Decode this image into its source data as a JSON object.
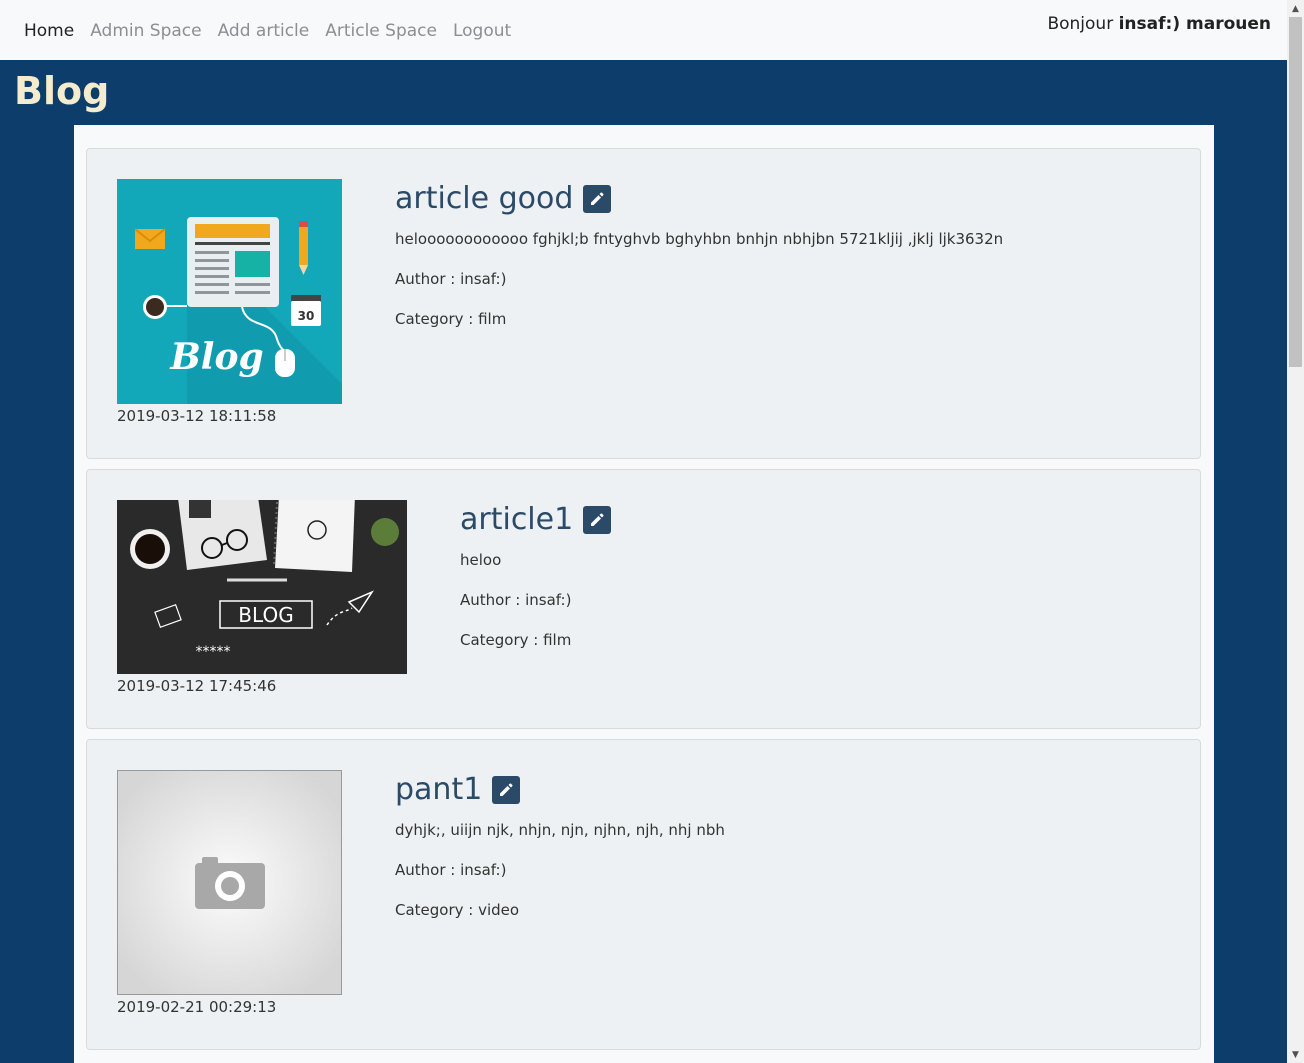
{
  "nav": {
    "links": [
      "Home",
      "Admin Space",
      "Add article",
      "Article Space",
      "Logout"
    ],
    "greeting_prefix": "Bonjour",
    "greeting_user": "insaf:) marouen"
  },
  "page_title": "Blog",
  "articles": [
    {
      "title": "article good",
      "description": "heloooooooooooo fghjkl;b fntyghvb bghyhbn bnhjn nbhjbn 5721kljij ,jklj ljk3632n",
      "author": "Author : insaf:)",
      "category": "Category : film",
      "date": "2019-03-12 18:11:58",
      "image": "blog-illustration-icon"
    },
    {
      "title": "article1",
      "description": "heloo",
      "author": "Author : insaf:)",
      "category": "Category : film",
      "date": "2019-03-12 17:45:46",
      "image": "blog-desk-photo"
    },
    {
      "title": "pant1",
      "description": "dyhjk;, uiijn njk, nhjn, njn, njhn, njh, nhj nbh",
      "author": "Author : insaf:)",
      "category": "Category : video",
      "date": "2019-02-21 00:29:13",
      "image": "camera-placeholder-icon"
    }
  ],
  "thumb_texts": {
    "blog_script": "Blog",
    "calendar_day": "30",
    "desk_label": "BLOG",
    "stars": "*****"
  },
  "colors": {
    "background": "#0d3d6b",
    "title_color": "#2b4a68",
    "blog_heading": "#f5ecd0",
    "card_bg": "#edf1f3"
  }
}
